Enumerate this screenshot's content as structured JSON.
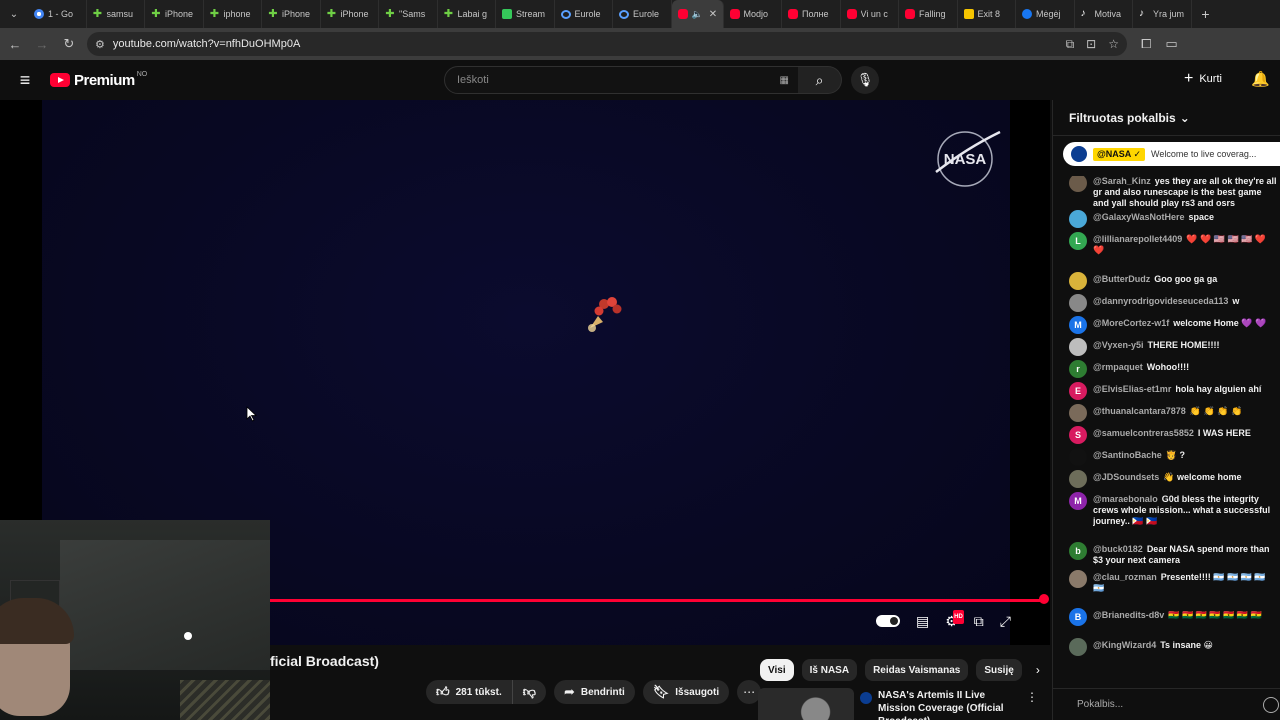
{
  "browser": {
    "tabs": [
      {
        "label": "1 - Go",
        "icon": "google-icon"
      },
      {
        "label": "samsu",
        "icon": "plus-icon"
      },
      {
        "label": "iPhone",
        "icon": "plus-icon"
      },
      {
        "label": "iphone",
        "icon": "plus-icon"
      },
      {
        "label": "iPhone",
        "icon": "plus-icon"
      },
      {
        "label": "iPhone",
        "icon": "plus-icon"
      },
      {
        "label": "\"Sams",
        "icon": "plus-icon"
      },
      {
        "label": "Labai g",
        "icon": "plus-icon"
      },
      {
        "label": "Stream",
        "icon": "k-icon"
      },
      {
        "label": "Eurole",
        "icon": "c-icon"
      },
      {
        "label": "Eurole",
        "icon": "c-icon"
      },
      {
        "label": "",
        "icon": "youtube-icon",
        "active": true
      },
      {
        "label": "Modjo",
        "icon": "youtube-icon"
      },
      {
        "label": "Полне",
        "icon": "youtube-icon"
      },
      {
        "label": "Vi un c",
        "icon": "youtube-icon"
      },
      {
        "label": "Falling",
        "icon": "youtube-icon"
      },
      {
        "label": "Exit 8",
        "icon": "exit8-icon"
      },
      {
        "label": "Mėgėj",
        "icon": "facebook-icon"
      },
      {
        "label": "Motiva",
        "icon": "tiktok-icon"
      },
      {
        "label": "Yra jum",
        "icon": "tiktok-icon"
      }
    ],
    "url": "youtube.com/watch?v=nfhDuOHMp0A"
  },
  "yt": {
    "brand": "Premium",
    "country": "NO",
    "search_placeholder": "Ieškoti",
    "create_label": "Kurti"
  },
  "video": {
    "title": "ficial Broadcast)",
    "progress_fraction": 1.0,
    "likes": "281 tūkst.",
    "share_label": "Bendrinti",
    "save_label": "Išsaugoti"
  },
  "chips": [
    "Visi",
    "Iš NASA",
    "Reidas Vaismanas",
    "Susiję"
  ],
  "recommendation": {
    "title": "NASA's Artemis II Live Mission Coverage (Official Broadcast)"
  },
  "chat": {
    "header": "Filtruotas pokalbis",
    "pinned_author": "@NASA",
    "pinned_text": "Welcome to live coverag...",
    "input_placeholder": "Pokalbis...",
    "messages": [
      {
        "author": "@Sarah_Kinz",
        "text": "yes they are all ok they're all gr and also runescape is the best game and yall should play rs3 and osrs",
        "avatar": "",
        "color": "#6b5b4a"
      },
      {
        "author": "@GalaxyWasNotHere",
        "text": "space",
        "avatar": "",
        "color": "#4aa8d8"
      },
      {
        "author": "@lillianarepollet4409",
        "text": "❤️ ❤️ 🇺🇸 🇺🇸 🇺🇸 ❤️ ❤️",
        "avatar": "L",
        "color": "#33a852"
      },
      {
        "author": "@ButterDudz",
        "text": "Goo goo ga ga",
        "avatar": "",
        "color": "#d9b33a"
      },
      {
        "author": "@dannyrodrigovideseuceda113",
        "text": "w",
        "avatar": "",
        "color": "#888888"
      },
      {
        "author": "@MoreCortez-w1f",
        "text": "welcome Home 💜 💜",
        "avatar": "M",
        "color": "#1a73e8"
      },
      {
        "author": "@Vyxen-y5i",
        "text": "THERE HOME!!!!",
        "avatar": "",
        "color": "#bdbdbd"
      },
      {
        "author": "@rmpaquet",
        "text": "Wohoo!!!!",
        "avatar": "r",
        "color": "#2e7d32"
      },
      {
        "author": "@ElvisElias-et1mr",
        "text": "hola hay alguien ahí",
        "avatar": "E",
        "color": "#d81b60"
      },
      {
        "author": "@thuanalcantara7878",
        "text": "👏 👏 👏 👏",
        "avatar": "",
        "color": "#7a6a5a"
      },
      {
        "author": "@samuelcontreras5852",
        "text": "I WAS HERE",
        "avatar": "S",
        "color": "#d81b60"
      },
      {
        "author": "@SantinoBache",
        "text": "🫅 ?",
        "avatar": "",
        "color": "#111111"
      },
      {
        "author": "@JDSoundsets",
        "text": "👋 welcome home",
        "avatar": "",
        "color": "#6d6d5a"
      },
      {
        "author": "@maraebonalo",
        "text": "G0d bless the integrity crews whole mission... what a successful journey.. 🇵🇭 🇵🇭",
        "avatar": "M",
        "color": "#8e24aa"
      },
      {
        "author": "@buck0182",
        "text": "Dear NASA spend more than $3 your next camera",
        "avatar": "b",
        "color": "#2e7d32"
      },
      {
        "author": "@clau_rozman",
        "text": "Presente!!!! 🇦🇷 🇦🇷 🇦🇷 🇦🇷 🇦🇷",
        "avatar": "",
        "color": "#8a7a6a"
      },
      {
        "author": "@Brianedits-d8v",
        "text": "🇬🇭 🇬🇭 🇬🇭 🇬🇭 🇬🇭 🇬🇭 🇬🇭",
        "avatar": "B",
        "color": "#1a73e8"
      },
      {
        "author": "@KingWizard4",
        "text": "Ts insane 😀",
        "avatar": "",
        "color": "#5a6a5a"
      }
    ]
  }
}
